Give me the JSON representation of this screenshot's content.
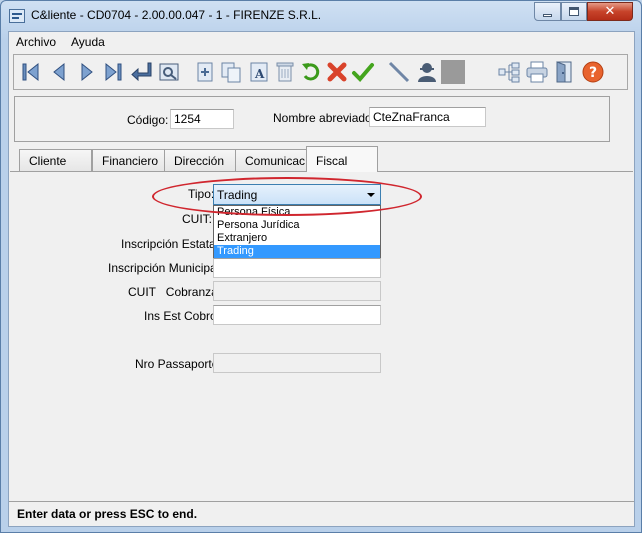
{
  "window": {
    "title": "C&liente - CD0704 - 2.00.00.047 - 1 - FIRENZE S.R.L."
  },
  "menu": [
    "Archivo",
    "Ayuda"
  ],
  "toolbar": {
    "icons": [
      "first-record-icon",
      "previous-record-icon",
      "next-record-icon",
      "last-record-icon",
      "enter-icon",
      "preview-icon",
      "new-record-icon",
      "copy-icon",
      "text-format-icon",
      "delete-icon",
      "undo-icon",
      "cancel-icon",
      "confirm-icon",
      "line-icon",
      "user-icon",
      "blank-icon",
      "tree-icon",
      "print-icon",
      "exit-door-icon",
      "help-icon"
    ]
  },
  "header": {
    "codigo_label": "Código:",
    "codigo_value": "1254",
    "nombre_label": "Nombre abreviado:",
    "nombre_value": "CteZnaFranca"
  },
  "tabs": [
    "Cliente",
    "Financiero",
    "Dirección",
    "Comunicac",
    "Fiscal"
  ],
  "active_tab": "Fiscal",
  "fiscal": {
    "tipo_label": "Tipo:",
    "tipo_value": "Trading",
    "tipo_options": [
      "Persona Física",
      "Persona Jurídica",
      "Extranjero",
      "Trading"
    ],
    "cuit_label": "CUIT:",
    "inscripcion_estatal_label": "Inscripción Estatal:",
    "inscripcion_municipal_label": "Inscripción Municipal:",
    "cuit_cobranza_label": "CUIT   Cobranza:",
    "ins_est_cobro_label": "Ins Est Cobro:",
    "nro_passaporte_label": "Nro Passaporte:"
  },
  "status": {
    "text": "Enter data or press ESC to end."
  },
  "colors": {
    "highlight": "#3399ff",
    "annotation": "#d0262e"
  }
}
